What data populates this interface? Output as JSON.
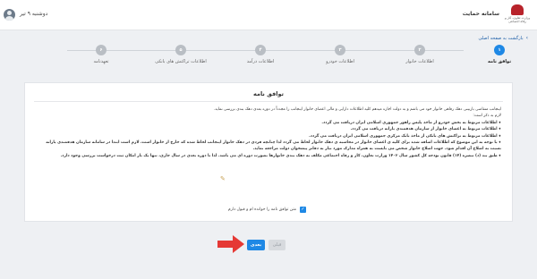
{
  "header": {
    "app_title": "سامانه حمایت",
    "logo_caption": "وزارت تعاون، کار و رفاه اجتماعی",
    "date": "دوشنبه ۹ تیر"
  },
  "nav": {
    "back_label": "بازگشت به صفحه اصلی",
    "back_icon": "chevron-right-icon"
  },
  "stepper": {
    "steps": [
      {
        "number": "۱",
        "label": "توافق نامه",
        "active": true
      },
      {
        "number": "۲",
        "label": "اطلاعات خانوار",
        "active": false
      },
      {
        "number": "۳",
        "label": "اطلاعات خودرو",
        "active": false
      },
      {
        "number": "۴",
        "label": "اطلاعات درآمد",
        "active": false
      },
      {
        "number": "۵",
        "label": "اطلاعات تراکنش های بانکی",
        "active": false
      },
      {
        "number": "۶",
        "label": "تعهدنامه",
        "active": false
      }
    ]
  },
  "agreement": {
    "title": "توافق نامه",
    "intro": "اینجانب متقاضی بازبینی دهک رفاهی خانوار خود می باشم و به دولت اجازه میدهم کلیه اطلاعات دارایی و مالی اعضای خانوار اینجانب را مجدداً در دوره بعدی دهک بندی بررسی نماید.",
    "note_heading": "لازم به ذکر است:",
    "bullets": [
      "اطلاعات مربوط به بخش خودرو از ماخذ پلیس راهور جمهوری اسلامی ایران دریافت می گردد.",
      "اطلاعات مربوط به اعضای خانوار از سازمان هدفمندی یارانه دریافت می گردد.",
      "اطلاعات مربوط به تراکنش های بانکی از ماخذ بانک مرکزی جمهوری اسلامی ایران دریافت می گردد.",
      "با توجه به این موضوع که اطلاعات اضافه شده برای کلیه ی اعضای خانوار در محاسبه ی دهک خانوار لحاظ می گردد لذا چنانچه فردی در دهک خانوار اینجانب لحاظ شده که خارج از خانوار است، لازم است ابتدا در سامانه سازمان هدفمندی یارانه نسبت به اصلاح آن اقدام شود. جهت اصلاح خانوار شخص می بایست به همراه مدارک مورد نیاز به دفاتر پیشخوان دولت مراجعه نماید.",
      "طبق بند (د) تبصره (۱۴) قانون بودجه کل کشور سال ۱۴۰۲ وزارت تعاون، کار و رفاه اجتماعی مکلف به دهک بندی خانوارها بصورت دوره ای می باشد. لذا تا دوره بعدی در سال جاری، تنها یک بار امکان ثبت درخواست بررسی وجود دارد."
    ],
    "consent_label": "متن توافق نامه را خوانده ام و قبول دارم",
    "consent_checked": true
  },
  "actions": {
    "next_label": "بعدی",
    "prev_label": "قبلی"
  },
  "colors": {
    "primary": "#1e88e5",
    "disabled": "#d7dade",
    "annotation_arrow": "#e53935"
  }
}
